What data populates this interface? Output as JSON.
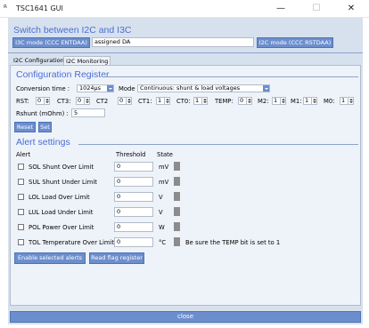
{
  "window": {
    "title": "TSC1641 GUI",
    "icon": "app-logo-icon",
    "controls": {
      "minimize": "—",
      "maximize": "☐",
      "close": "✕"
    }
  },
  "i3c": {
    "title": "Switch between I2C and I3C",
    "entdaa_button": "I3C mode (CCC ENTDAA)",
    "da_value": "assigned DA",
    "rstdaa_button": "I2C mode (CCC RSTDAA)"
  },
  "tabs": [
    {
      "label": "I2C Configuration",
      "active": false
    },
    {
      "label": "I2C Monitoring",
      "active": true
    }
  ],
  "config": {
    "title": "Configuration Register",
    "conversion_time_label": "Conversion time :",
    "conversion_time_value": "1024µs",
    "mode_label": "Mode :",
    "mode_value": "Continuous: shunt & load voltages",
    "fields": [
      {
        "label": "RST:",
        "value": "0"
      },
      {
        "label": "CT3:",
        "value": "0"
      },
      {
        "label": "CT2",
        "value": "0"
      },
      {
        "label": "CT1:",
        "value": "1"
      },
      {
        "label": "CT0:",
        "value": "1"
      },
      {
        "label": "TEMP:",
        "value": "0"
      },
      {
        "label": "M2:",
        "value": "1"
      },
      {
        "label": "M1:",
        "value": "1"
      },
      {
        "label": "M0:",
        "value": "1"
      }
    ],
    "rshunt_label": "Rshunt (mOhm) :",
    "rshunt_value": "5",
    "reset_button": "Reset",
    "set_button": "Set"
  },
  "alerts": {
    "title": "Alert settings",
    "headers": {
      "alert": "Alert",
      "threshold": "Threshold",
      "state": "State"
    },
    "rows": [
      {
        "label": "SOL Shunt Over Limit",
        "threshold": "0",
        "unit": "mV",
        "checked": false
      },
      {
        "label": "SUL Shunt Under Limit",
        "threshold": "0",
        "unit": "mV",
        "checked": false
      },
      {
        "label": "LOL Load Over Limit",
        "threshold": "0",
        "unit": "V",
        "checked": false
      },
      {
        "label": "LUL Load Under Limit",
        "threshold": "0",
        "unit": "V",
        "checked": false
      },
      {
        "label": "POL Power Over Limit",
        "threshold": "0",
        "unit": "W",
        "checked": false
      },
      {
        "label": "TOL Temperature Over Limit",
        "threshold": "0",
        "unit": "°C",
        "checked": false
      }
    ],
    "temp_note": "Be sure the TEMP bit is set to 1",
    "enable_button": "Enable selected alerts",
    "read_flag_button": "Read flag register"
  },
  "footer": {
    "close_label": "close"
  },
  "colors": {
    "accent": "#4a6ed6",
    "button": "#6c8ecd",
    "background": "#d7e1ee",
    "panel": "#eef3fa",
    "state_off": "#8c8c8c"
  }
}
